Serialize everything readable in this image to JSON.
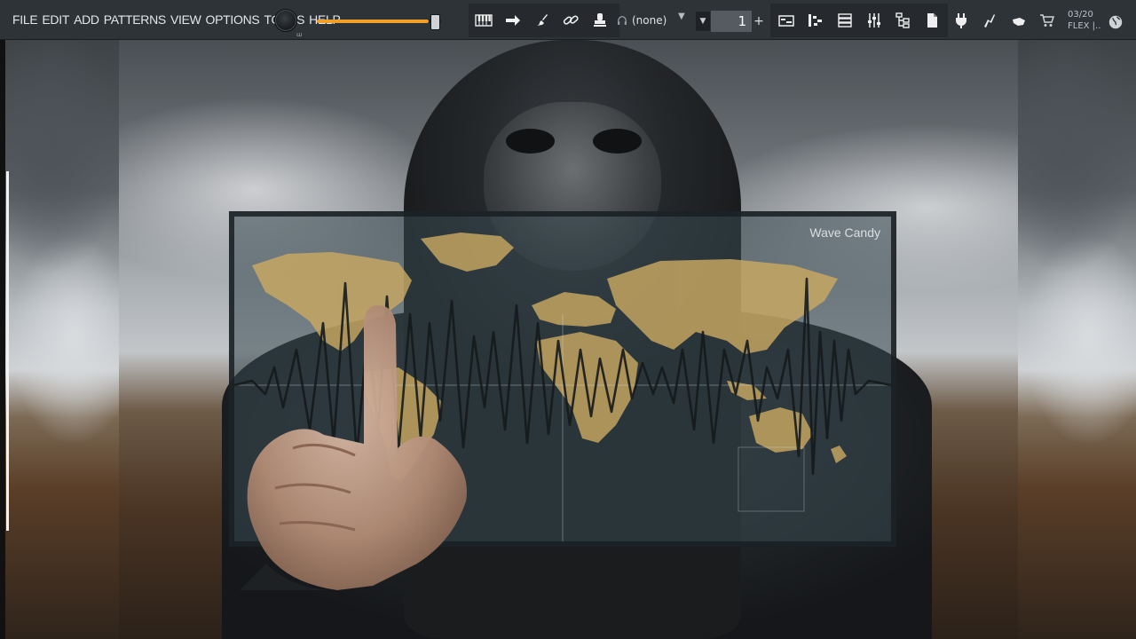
{
  "menu": {
    "items": [
      "FILE",
      "EDIT",
      "ADD",
      "PATTERNS",
      "VIEW",
      "OPTIONS",
      "TOOLS",
      "HELP"
    ]
  },
  "toolbar": {
    "master_volume": 0.9,
    "pattern_select": "(none)",
    "pattern_number": "1",
    "plus_label": "+",
    "info_line1": "03/20",
    "info_line2": "FLEX |..",
    "knob_mark": "ш",
    "accent_color": "#f0a028"
  },
  "wave_candy": {
    "title": "Wave Candy"
  }
}
